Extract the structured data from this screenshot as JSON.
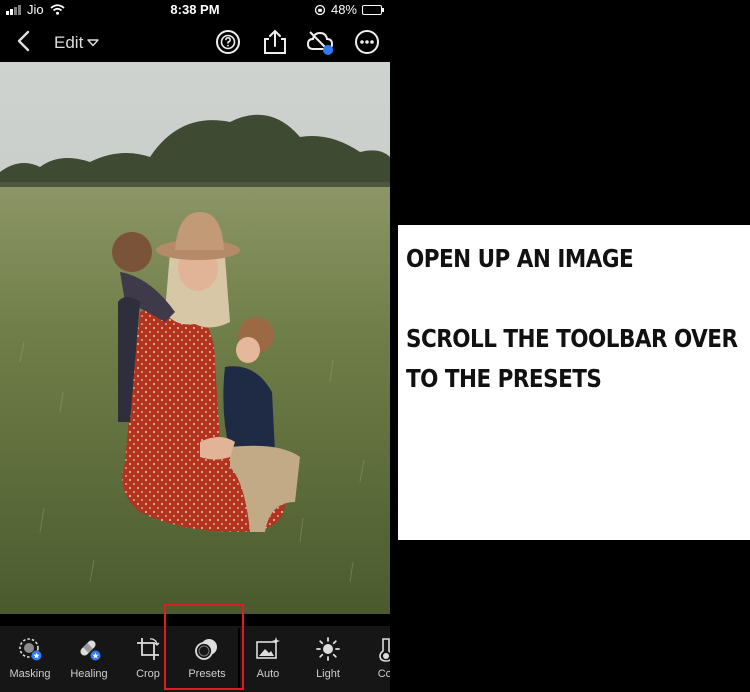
{
  "status_bar": {
    "carrier": "Jio",
    "time": "8:38 PM",
    "battery": "48%",
    "battery_level": 0.48
  },
  "top_bar": {
    "mode_label": "Edit",
    "icons": [
      "back-icon",
      "help-icon",
      "share-icon",
      "cloud-sync-icon",
      "more-icon"
    ]
  },
  "toolbar": {
    "items": [
      {
        "label": "Masking",
        "icon": "masking-icon"
      },
      {
        "label": "Healing",
        "icon": "healing-icon"
      },
      {
        "label": "Crop",
        "icon": "crop-icon"
      },
      {
        "label": "Presets",
        "icon": "presets-icon",
        "highlighted": true
      },
      {
        "label": "Auto",
        "icon": "auto-icon"
      },
      {
        "label": "Light",
        "icon": "light-icon"
      },
      {
        "label": "Col",
        "icon": "color-icon"
      }
    ]
  },
  "colors": {
    "highlight": "#e01b24",
    "accent_blue": "#2f7bf6"
  },
  "instructions": {
    "line1": "OPEN UP AN IMAGE",
    "line2": "SCROLL THE TOOLBAR OVER",
    "line3": "TO THE PRESETS"
  }
}
